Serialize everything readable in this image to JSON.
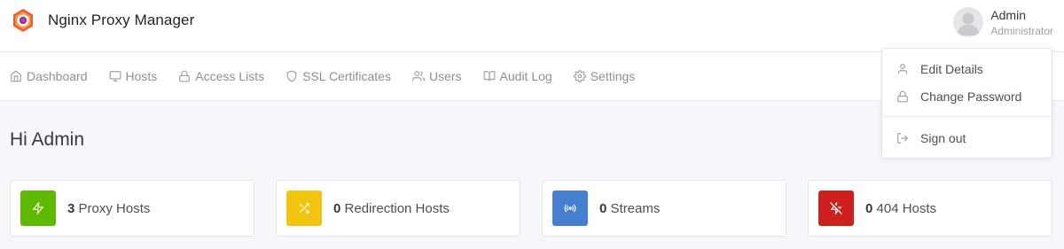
{
  "app": {
    "title": "Nginx Proxy Manager"
  },
  "user": {
    "name": "Admin",
    "role": "Administrator"
  },
  "nav": [
    {
      "label": "Dashboard",
      "icon": "home-icon"
    },
    {
      "label": "Hosts",
      "icon": "monitor-icon"
    },
    {
      "label": "Access Lists",
      "icon": "lock-icon"
    },
    {
      "label": "SSL Certificates",
      "icon": "shield-icon"
    },
    {
      "label": "Users",
      "icon": "users-icon"
    },
    {
      "label": "Audit Log",
      "icon": "book-icon"
    },
    {
      "label": "Settings",
      "icon": "gear-icon"
    }
  ],
  "page": {
    "greeting": "Hi Admin"
  },
  "cards": [
    {
      "count": "3",
      "label": "Proxy Hosts",
      "color": "#5eba00",
      "icon": "zap-icon"
    },
    {
      "count": "0",
      "label": "Redirection Hosts",
      "color": "#f1c40f",
      "icon": "shuffle-icon"
    },
    {
      "count": "0",
      "label": "Streams",
      "color": "#467fcf",
      "icon": "radio-icon"
    },
    {
      "count": "0",
      "label": "404 Hosts",
      "color": "#cd201f",
      "icon": "zap-off-icon"
    }
  ],
  "user_menu": {
    "edit_details": "Edit Details",
    "change_password": "Change Password",
    "sign_out": "Sign out"
  }
}
